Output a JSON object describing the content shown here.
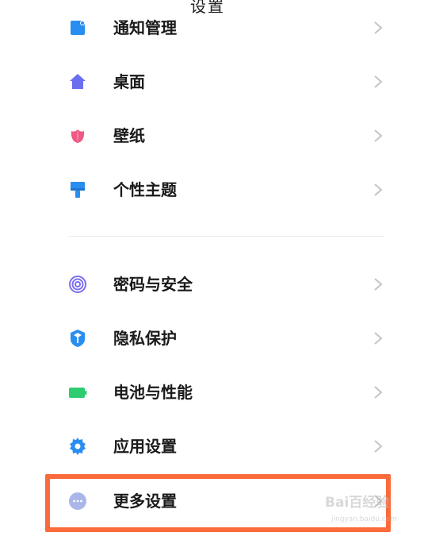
{
  "top_title": "设置",
  "groups": [
    {
      "items": [
        {
          "label": "通知管理",
          "icon": "notification-icon"
        },
        {
          "label": "桌面",
          "icon": "home-icon"
        },
        {
          "label": "壁纸",
          "icon": "tulip-icon"
        },
        {
          "label": "个性主题",
          "icon": "brush-icon"
        }
      ]
    },
    {
      "items": [
        {
          "label": "密码与安全",
          "icon": "fingerprint-icon"
        },
        {
          "label": "隐私保护",
          "icon": "privacy-shield-icon"
        },
        {
          "label": "电池与性能",
          "icon": "battery-icon"
        },
        {
          "label": "应用设置",
          "icon": "gear-icon"
        },
        {
          "label": "更多设置",
          "icon": "more-dots-icon"
        }
      ]
    }
  ],
  "colors": {
    "notification": "#2a8df0",
    "home": "#6c6ef0",
    "tulip": "#ee5a83",
    "brush": "#2a8df0",
    "fingerprint": "#7b6ff0",
    "privacy": "#2a8df0",
    "battery": "#2ecc71",
    "gear": "#2a8df0",
    "more": "#a9b6e8",
    "highlight": "#fb6a3b"
  },
  "watermark": {
    "brand": "Bai百经验",
    "sub": "jingyan.baidu.com"
  }
}
